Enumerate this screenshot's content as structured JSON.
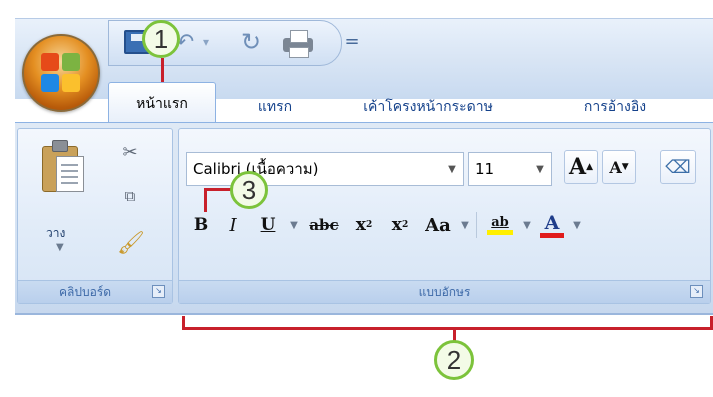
{
  "tabs": [
    "หน้าแรก",
    "แทรก",
    "เค้าโครงหน้ากระดาษ",
    "การอ้างอิง"
  ],
  "quick_access": {
    "icons": [
      "save-icon",
      "undo-icon",
      "redo-icon",
      "quick-print-icon",
      "customize-quick-access-icon"
    ],
    "customize_glyph": "="
  },
  "clipboard": {
    "paste_label": "วาง",
    "caption": "คลิปบอร์ด"
  },
  "font": {
    "font_name": "Calibri (เนื้อความ)",
    "font_size": "11",
    "caption": "แบบอักษร",
    "buttons": {
      "bold": "B",
      "italic": "I",
      "underline": "U",
      "strikethrough": "abc",
      "subscript": "x",
      "superscript": "x",
      "change_case": "Aa",
      "grow_font": "A",
      "shrink_font": "A",
      "highlight": "ab",
      "font_color": "A"
    }
  },
  "callouts": [
    "1",
    "2",
    "3"
  ],
  "colors": {
    "callout_border": "#7cc33b",
    "callout_line": "#c8202b",
    "ribbon_blue": "#d2e1f3",
    "tab_text": "#15428b",
    "highlight_yellow": "#ffef00",
    "font_color_red": "#e01b1b"
  }
}
